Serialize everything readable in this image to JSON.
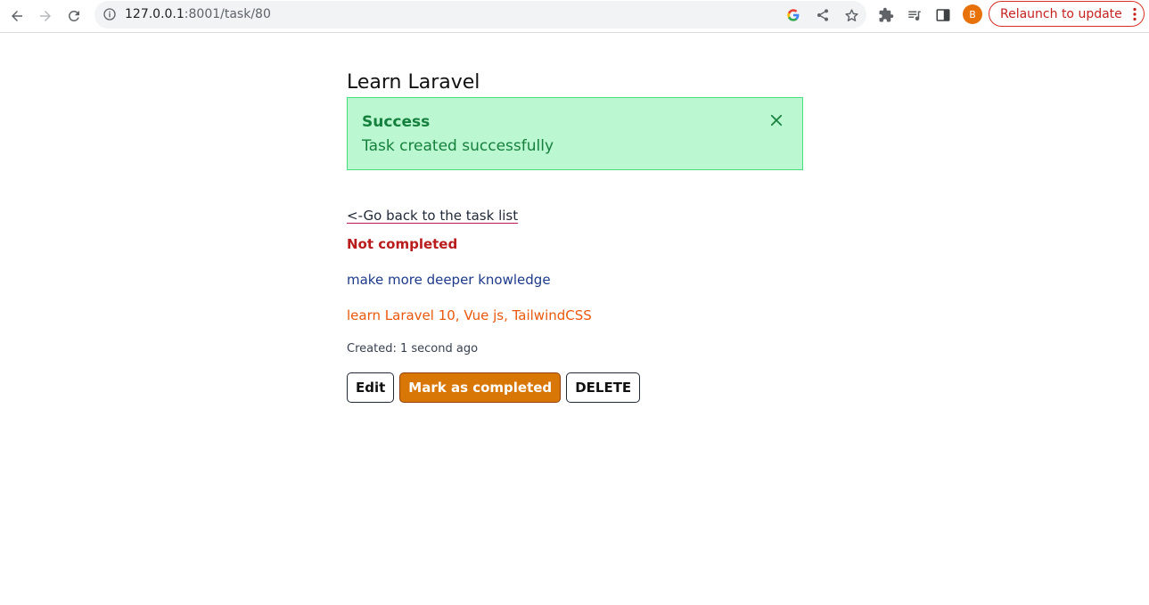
{
  "browser": {
    "url_host": "127.0.0.1",
    "url_rest": ":8001/task/80",
    "avatar_letter": "B",
    "relaunch_label": "Relaunch to update"
  },
  "task": {
    "title": "Learn Laravel",
    "status": "Not completed",
    "description": "make more deeper knowledge",
    "long_description": "learn Laravel 10, Vue js, TailwindCSS",
    "created": "Created: 1 second ago"
  },
  "alert": {
    "title": "Success",
    "message": "Task created successfully"
  },
  "links": {
    "back": "<-Go back to the task list"
  },
  "actions": {
    "edit": "Edit",
    "toggle": "Mark as completed",
    "delete": "DELETE"
  },
  "colors": {
    "alert_bg": "#bbf7d0",
    "alert_text": "#15803d",
    "status_text": "#b91c1c",
    "primary_button": "#d97706"
  },
  "icons": [
    "back-arrow-icon",
    "forward-arrow-icon",
    "reload-icon",
    "info-icon",
    "google-icon",
    "share-icon",
    "star-icon",
    "extensions-icon",
    "media-queue-icon",
    "side-panel-icon",
    "more-vert-icon",
    "close-icon"
  ]
}
